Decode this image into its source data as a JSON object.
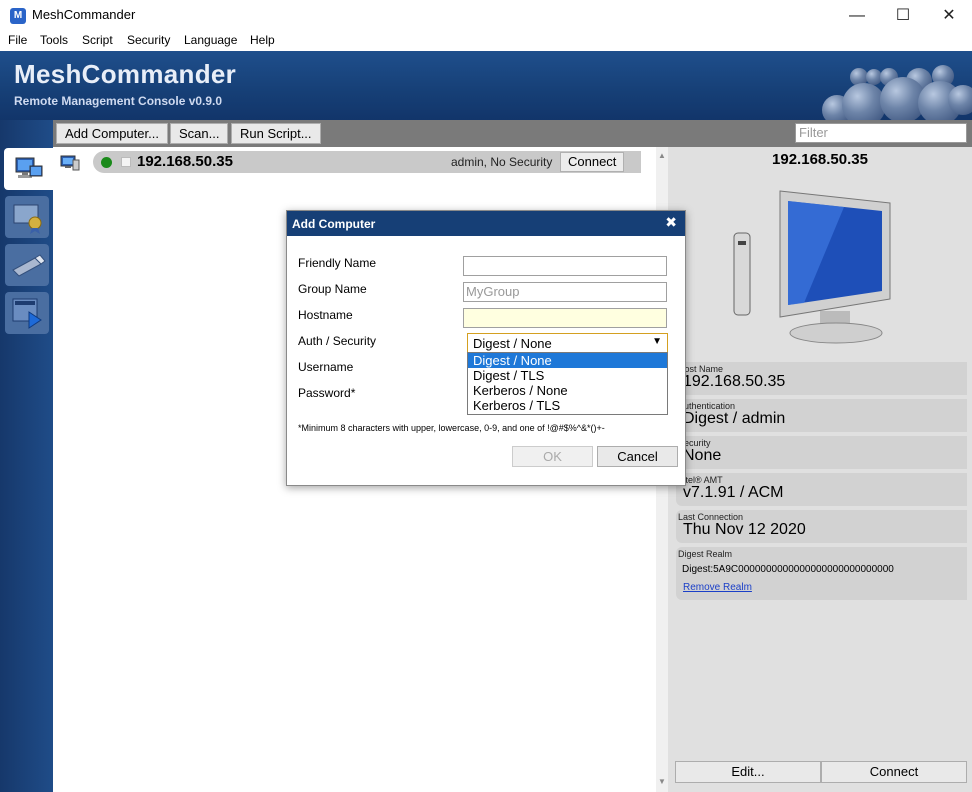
{
  "window": {
    "title": "MeshCommander",
    "minimize_glyph": "—",
    "maximize_glyph": "☐",
    "close_glyph": "✕"
  },
  "menu": [
    "File",
    "Tools",
    "Script",
    "Security",
    "Language",
    "Help"
  ],
  "banner": {
    "title": "MeshCommander",
    "subtitle": "Remote Management Console v0.9.0"
  },
  "toolbar": {
    "add_computer": "Add Computer...",
    "scan": "Scan...",
    "run_script": "Run Script...",
    "filter_placeholder": "Filter"
  },
  "computer_list": [
    {
      "host": "192.168.50.35",
      "status_text": "admin, No Security",
      "connect_label": "Connect",
      "status_color": "#1a8a1a"
    }
  ],
  "details": {
    "header_ip": "192.168.50.35",
    "properties": [
      {
        "label": "Host Name",
        "value": "192.168.50.35"
      },
      {
        "label": "Authentication",
        "value": "Digest / admin"
      },
      {
        "label": "Security",
        "value": "None"
      },
      {
        "label": "Intel® AMT",
        "value": "v7.1.91 / ACM"
      },
      {
        "label": "Last Connection",
        "value": "Thu Nov 12 2020"
      }
    ],
    "digest_realm": {
      "label": "Digest Realm",
      "value": "Digest:5A9C0000000000000000000000000000",
      "link": "Remove Realm"
    },
    "edit_button": "Edit...",
    "connect_button": "Connect"
  },
  "dialog": {
    "title": "Add Computer",
    "close_glyph": "✖",
    "fields": {
      "friendly_name_label": "Friendly Name",
      "friendly_name_value": "",
      "group_name_label": "Group Name",
      "group_name_placeholder": "MyGroup",
      "hostname_label": "Hostname",
      "hostname_value": "",
      "auth_label": "Auth / Security",
      "auth_selected": "Digest / None",
      "auth_options": [
        "Digest / None",
        "Digest / TLS",
        "Kerberos / None",
        "Kerberos / TLS"
      ],
      "username_label": "Username",
      "password_label": "Password*"
    },
    "note": "*Minimum 8 characters with upper, lowercase, 0-9, and one of !@#$%^&*()+-",
    "ok_label": "OK",
    "cancel_label": "Cancel"
  },
  "colors": {
    "banner": "#163f76",
    "sidebar": "#1f4c88",
    "selection": "#1e78d8",
    "toolbar": "#7a7a7a"
  }
}
